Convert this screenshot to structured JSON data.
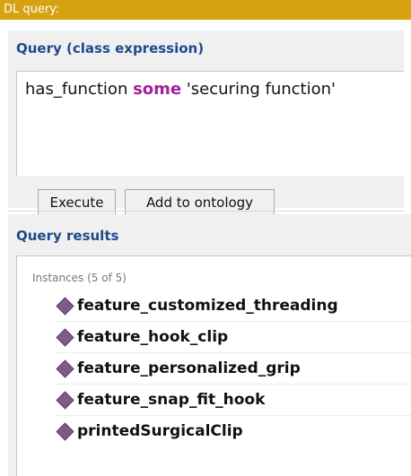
{
  "window": {
    "title": "DL query:"
  },
  "query": {
    "section_title": "Query (class expression)",
    "expression": {
      "before": "has_function ",
      "keyword": "some",
      "after": " 'securing function'"
    },
    "execute_label": "Execute",
    "add_label": "Add to ontology"
  },
  "results": {
    "section_title": "Query results",
    "header": "Instances (5 of 5)",
    "items": [
      {
        "label": "feature_customized_threading",
        "icon": "individual-diamond-icon"
      },
      {
        "label": "feature_hook_clip",
        "icon": "individual-diamond-icon"
      },
      {
        "label": "feature_personalized_grip",
        "icon": "individual-diamond-icon"
      },
      {
        "label": "feature_snap_fit_hook",
        "icon": "individual-diamond-icon"
      },
      {
        "label": "printedSurgicalClip",
        "icon": "individual-diamond-icon"
      }
    ]
  },
  "colors": {
    "title_bar": "#d6a210",
    "section_title": "#1e4a8c",
    "keyword": "#a020a0",
    "individual_icon": "#7d5a8a"
  }
}
